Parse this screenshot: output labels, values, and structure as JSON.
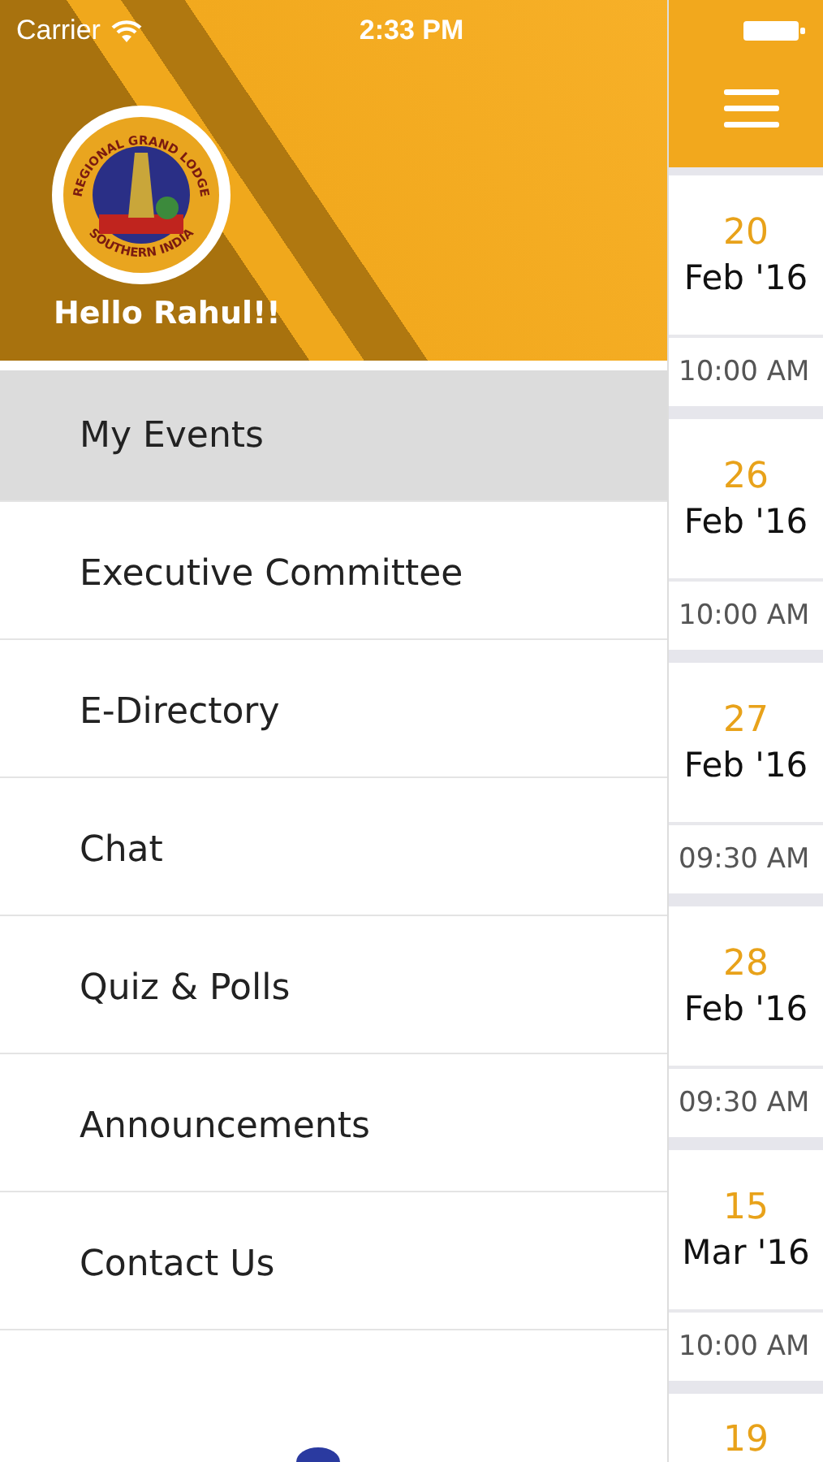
{
  "status_bar": {
    "carrier": "Carrier",
    "time": "2:33 PM"
  },
  "drawer": {
    "logo": {
      "top_text": "REGIONAL GRAND LODGE",
      "bottom_text": "SOUTHERN INDIA"
    },
    "greeting": "Hello Rahul!!",
    "items": [
      {
        "label": "My Events",
        "selected": true
      },
      {
        "label": "Executive Committee",
        "selected": false
      },
      {
        "label": "E-Directory",
        "selected": false
      },
      {
        "label": "Chat",
        "selected": false
      },
      {
        "label": "Quiz & Polls",
        "selected": false
      },
      {
        "label": "Announcements",
        "selected": false
      },
      {
        "label": "Contact Us",
        "selected": false
      }
    ]
  },
  "events": [
    {
      "day": "20",
      "month": "Feb '16",
      "time": "10:00 AM"
    },
    {
      "day": "26",
      "month": "Feb '16",
      "time": "10:00 AM"
    },
    {
      "day": "27",
      "month": "Feb '16",
      "time": "09:30 AM"
    },
    {
      "day": "28",
      "month": "Feb '16",
      "time": "09:30 AM"
    },
    {
      "day": "15",
      "month": "Mar '16",
      "time": "10:00 AM"
    },
    {
      "day": "19"
    }
  ]
}
